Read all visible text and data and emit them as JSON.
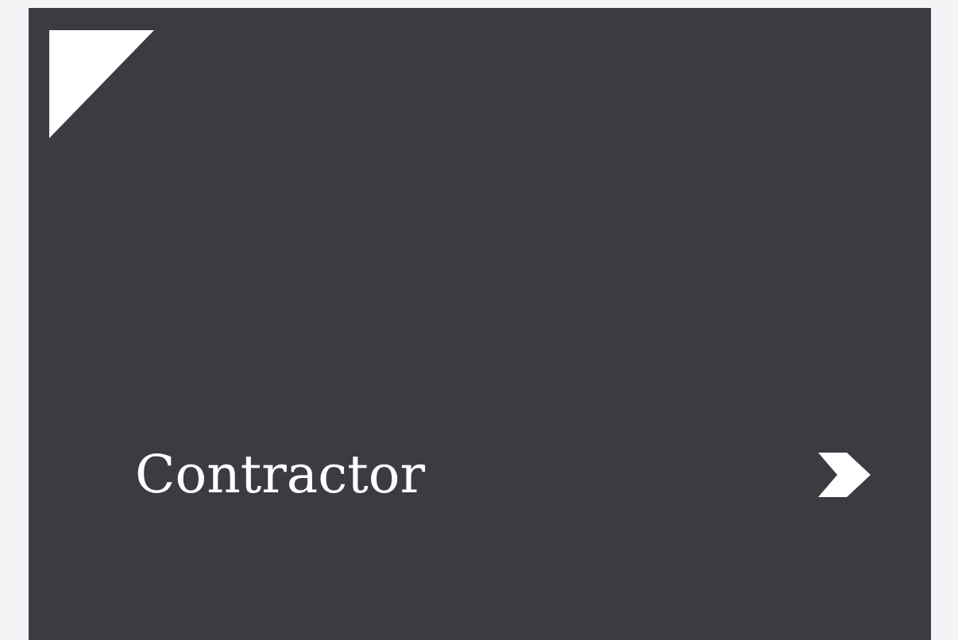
{
  "card": {
    "title": "Contractor"
  }
}
